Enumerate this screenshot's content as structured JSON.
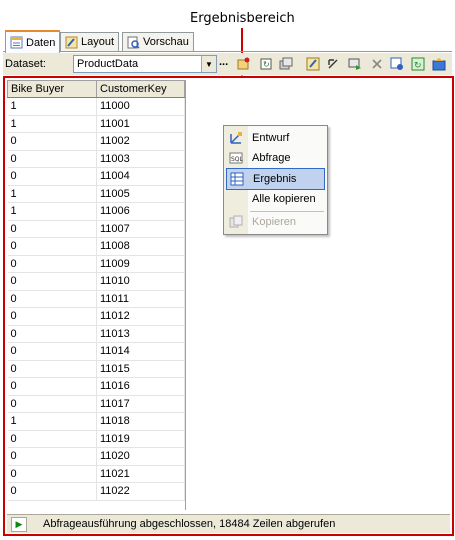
{
  "callout": {
    "label": "Ergebnisbereich",
    "color": "#cc0000"
  },
  "tabs": [
    {
      "label": "Daten",
      "icon": "data-icon",
      "active": true
    },
    {
      "label": "Layout",
      "icon": "layout-icon",
      "active": false
    },
    {
      "label": "Vorschau",
      "icon": "preview-icon",
      "active": false
    }
  ],
  "toolbar": {
    "dataset_label": "Dataset:",
    "dataset_value": "ProductData",
    "ellipsis": "...",
    "icons": [
      "new-dataset-icon",
      "delete-icon",
      "refresh-fields-icon",
      "edit-fields-icon",
      "command-type-icon",
      "generic-query-icon",
      "run-icon",
      "remove-icon",
      "import-icon",
      "prepare-icon",
      "parameters-icon"
    ]
  },
  "grid": {
    "columns": [
      "Bike Buyer",
      "CustomerKey"
    ],
    "rows": [
      [
        "1",
        "11000"
      ],
      [
        "1",
        "11001"
      ],
      [
        "0",
        "11002"
      ],
      [
        "0",
        "11003"
      ],
      [
        "0",
        "11004"
      ],
      [
        "1",
        "11005"
      ],
      [
        "1",
        "11006"
      ],
      [
        "0",
        "11007"
      ],
      [
        "0",
        "11008"
      ],
      [
        "0",
        "11009"
      ],
      [
        "0",
        "11010"
      ],
      [
        "0",
        "11011"
      ],
      [
        "0",
        "11012"
      ],
      [
        "0",
        "11013"
      ],
      [
        "0",
        "11014"
      ],
      [
        "0",
        "11015"
      ],
      [
        "0",
        "11016"
      ],
      [
        "0",
        "11017"
      ],
      [
        "1",
        "11018"
      ],
      [
        "0",
        "11019"
      ],
      [
        "0",
        "11020"
      ],
      [
        "0",
        "11021"
      ],
      [
        "0",
        "11022"
      ]
    ]
  },
  "context_menu": {
    "items": [
      {
        "label": "Entwurf",
        "icon": "design-icon",
        "selected": false,
        "disabled": false
      },
      {
        "label": "Abfrage",
        "icon": "sql-icon",
        "selected": false,
        "disabled": false
      },
      {
        "label": "Ergebnis",
        "icon": "grid-icon",
        "selected": true,
        "disabled": false
      },
      {
        "label": "Alle kopieren",
        "icon": "",
        "selected": false,
        "disabled": false
      },
      {
        "label": "Kopieren",
        "icon": "copy-icon",
        "selected": false,
        "disabled": true
      }
    ]
  },
  "status": {
    "message": "Abfrageausführung abgeschlossen, 18484 Zeilen abgerufen"
  }
}
